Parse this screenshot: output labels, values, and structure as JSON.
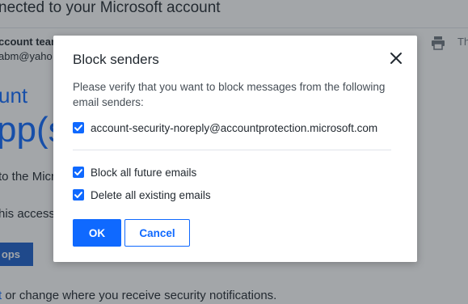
{
  "background": {
    "subject": "nected to your Microsoft account",
    "sender_name": "ccount team",
    "sender_email": "abm@yaho",
    "toolbar_text": "Th",
    "heading_small": "unt",
    "heading_large": "pp(s)",
    "body_line1": "to the Micro",
    "body_line2": "his access,",
    "button_label": "ops",
    "footer_link": "t",
    "footer_text": " or change where you receive security notifications."
  },
  "dialog": {
    "title": "Block senders",
    "description": "Please verify that you want to block messages from the following email senders:",
    "senders": [
      {
        "email": "account-security-noreply@accountprotection.microsoft.com",
        "checked": true
      }
    ],
    "options": [
      {
        "label": "Block all future emails",
        "checked": true
      },
      {
        "label": "Delete all existing emails",
        "checked": true
      }
    ],
    "ok_label": "OK",
    "cancel_label": "Cancel"
  },
  "colors": {
    "accent": "#0f69ff",
    "overlay": "#232a31",
    "text": "#232a31"
  },
  "icons": {
    "close": "close-icon",
    "print": "print-icon",
    "checkmark": "checkmark-icon"
  }
}
